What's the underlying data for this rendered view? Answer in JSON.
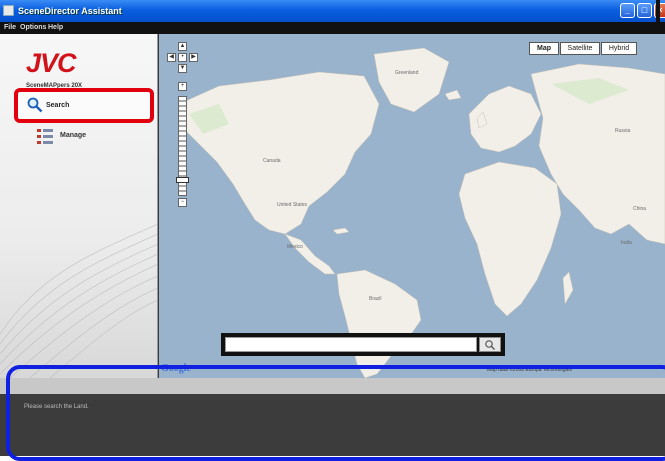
{
  "window": {
    "title": "SceneDirector Assistant",
    "buttons": {
      "minimize": "_",
      "maximize": "□",
      "close": "×"
    }
  },
  "menu": [
    "File",
    "Options",
    "Help"
  ],
  "sidebar": {
    "logo": "JVC",
    "product": "SceneMAPpers 20X",
    "items": [
      {
        "label": "Search",
        "icon": "search-icon",
        "selected": true
      },
      {
        "label": "Manage",
        "icon": "list-icon",
        "selected": false
      }
    ]
  },
  "map": {
    "types": [
      "Map",
      "Satellite",
      "Hybrid"
    ],
    "active_type": "Map",
    "search": {
      "value": "",
      "placeholder": ""
    },
    "provider": "Google",
    "attribution": "Map data ©2008 Europa Technologies",
    "labels": {
      "greenland": "Greenland",
      "canada": "Canada",
      "united_states": "United States",
      "mexico": "Mexico",
      "brazil": "Brazil",
      "russia": "Russia",
      "india": "India",
      "china": "China"
    },
    "colors": {
      "water": "#99b3cc",
      "land": "#f2efe9",
      "accent": "#e2000f",
      "highlight": "#1020e0"
    }
  },
  "status": {
    "message": "Please search the Land."
  }
}
